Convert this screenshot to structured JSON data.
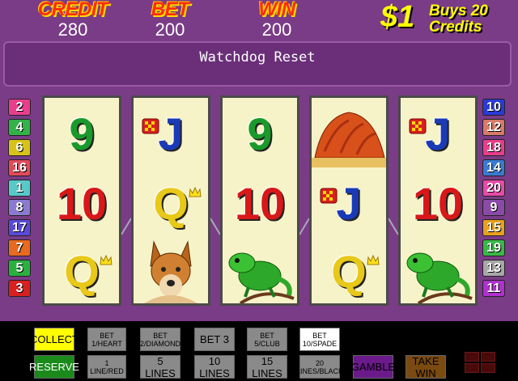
{
  "header": {
    "credit_label": "CREDIT",
    "credit_value": "280",
    "bet_label": "BET",
    "bet_value": "200",
    "win_label": "WIN",
    "win_value": "200",
    "buys_big": "$1",
    "buys_line1": "Buys 20",
    "buys_line2": "Credits"
  },
  "message": "Watchdog Reset",
  "left_markers": [
    {
      "label": "2",
      "color": "#e83e8c"
    },
    {
      "label": "4",
      "color": "#33b24a"
    },
    {
      "label": "6",
      "color": "#d8c21a"
    },
    {
      "label": "16",
      "color": "#e24a5a"
    },
    {
      "label": "1",
      "color": "#58c8c8"
    },
    {
      "label": "8",
      "color": "#8a7ad0"
    },
    {
      "label": "17",
      "color": "#5a4ad8"
    },
    {
      "label": "7",
      "color": "#e86a20"
    },
    {
      "label": "5",
      "color": "#2ab040"
    },
    {
      "label": "3",
      "color": "#d82020"
    }
  ],
  "right_markers": [
    {
      "label": "10",
      "color": "#2a3ad8"
    },
    {
      "label": "12",
      "color": "#d87a6a"
    },
    {
      "label": "18",
      "color": "#e83e8c"
    },
    {
      "label": "14",
      "color": "#3a7ad0"
    },
    {
      "label": "20",
      "color": "#e84aa8"
    },
    {
      "label": "9",
      "color": "#8a4aa8"
    },
    {
      "label": "15",
      "color": "#e8a020"
    },
    {
      "label": "19",
      "color": "#3ab848"
    },
    {
      "label": "13",
      "color": "#a8a8a8"
    },
    {
      "label": "11",
      "color": "#b030d0"
    }
  ],
  "reels": [
    [
      "9",
      "10",
      "Q"
    ],
    [
      "J",
      "Q",
      "dingo"
    ],
    [
      "9",
      "10",
      "lizard"
    ],
    [
      "uluru",
      "J",
      "Q"
    ],
    [
      "J",
      "10",
      "lizard"
    ]
  ],
  "symbol_colors": {
    "9": "#1a9a2a",
    "10": "#d81818",
    "J": "#1a3ab8",
    "Q": "#e8c818"
  },
  "buttons": {
    "collect": "COLLECT",
    "reserve": "RESERVE",
    "bet1_heart": "BET 1/HEART",
    "line1_red": "1 LINE/RED",
    "bet2_diamond": "BET 2/DIAMOND",
    "lines5": "5 LINES",
    "bet3": "BET 3",
    "lines10": "10 LINES",
    "bet5_club": "BET 5/CLUB",
    "lines15": "15 LINES",
    "bet10_spade": "BET 10/SPADE",
    "lines20_black": "20 LINES/BLACK",
    "gamble": "GAMBLE",
    "take_win": "TAKE WIN"
  },
  "colors": {
    "background": "#7a3c86",
    "collect": "#ffff00",
    "reserve": "#1a8a1a",
    "gray_button": "#8a8a8a",
    "bet10": "#ffffff",
    "gamble": "#6a1a8a",
    "take_win": "#7a4a10"
  }
}
